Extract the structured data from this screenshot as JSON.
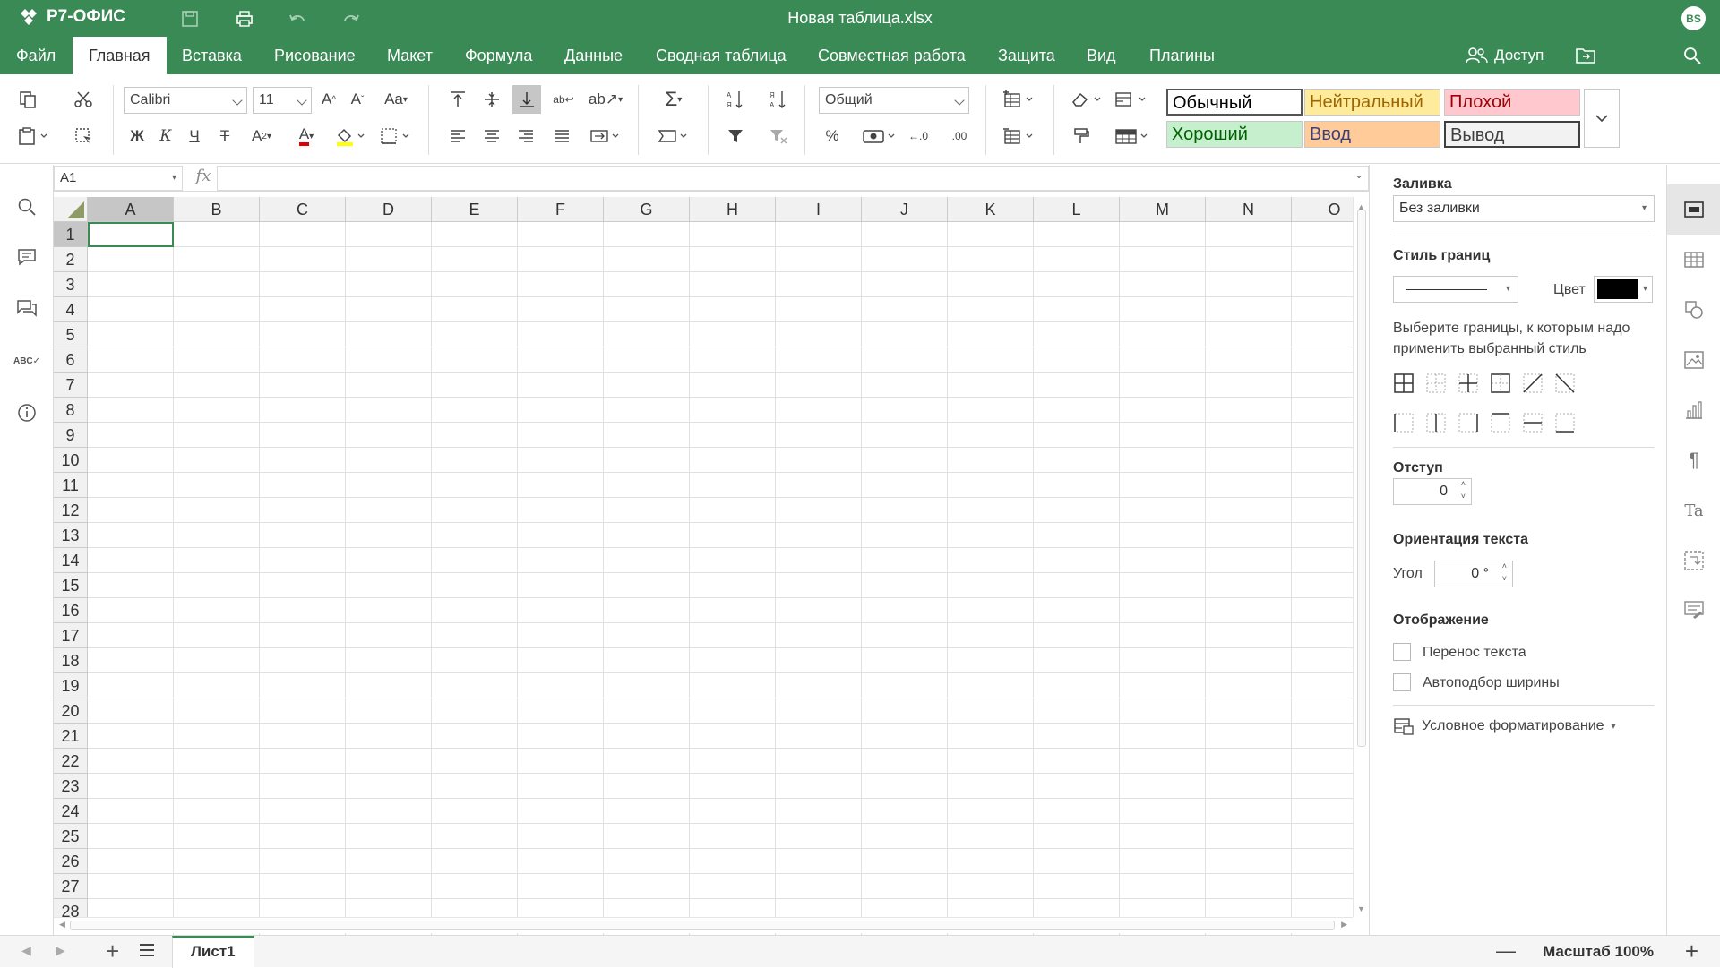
{
  "app": {
    "logo": "Р7-ОФИС",
    "title": "Новая таблица.xlsx",
    "user_initials": "BS"
  },
  "menu": {
    "tabs": [
      "Файл",
      "Главная",
      "Вставка",
      "Рисование",
      "Макет",
      "Формула",
      "Данные",
      "Сводная таблица",
      "Совместная работа",
      "Защита",
      "Вид",
      "Плагины"
    ],
    "active": "Главная",
    "access": "Доступ"
  },
  "toolbar": {
    "font_name": "Calibri",
    "font_size": "11",
    "number_format": "Общий",
    "styles": [
      {
        "name": "Обычный",
        "bg": "#ffffff",
        "fg": "#000000"
      },
      {
        "name": "Нейтральный",
        "bg": "#ffeb9c",
        "fg": "#9c6500"
      },
      {
        "name": "Плохой",
        "bg": "#ffc7ce",
        "fg": "#9c0006"
      },
      {
        "name": "Хороший",
        "bg": "#c6efce",
        "fg": "#006100"
      },
      {
        "name": "Ввод",
        "bg": "#ffcc99",
        "fg": "#3f3f76"
      },
      {
        "name": "Вывод",
        "bg": "#f2f2f2",
        "fg": "#3f3f3f"
      }
    ]
  },
  "formula": {
    "cell_ref": "A1",
    "fx": "fx",
    "content": ""
  },
  "sheet": {
    "columns": [
      "A",
      "B",
      "C",
      "D",
      "E",
      "F",
      "G",
      "H",
      "I",
      "J",
      "K",
      "L",
      "M",
      "N",
      "O"
    ],
    "rows": [
      "1",
      "2",
      "3",
      "4",
      "5",
      "6",
      "7",
      "8",
      "9",
      "10",
      "11",
      "12",
      "13",
      "14",
      "15",
      "16",
      "17",
      "18",
      "19",
      "20",
      "21",
      "22",
      "23",
      "24",
      "25",
      "26",
      "27",
      "28"
    ],
    "selected_col": "A",
    "selected_row": "1"
  },
  "panel": {
    "fill_label": "Заливка",
    "fill_value": "Без заливки",
    "border_style_label": "Стиль границ",
    "color_label": "Цвет",
    "border_color": "#000000",
    "border_hint": "Выберите границы, к которым надо применить выбранный стиль",
    "indent_label": "Отступ",
    "indent_value": "0",
    "orientation_label": "Ориентация текста",
    "angle_label": "Угол",
    "angle_value": "0 °",
    "display_label": "Отображение",
    "wrap_text": "Перенос текста",
    "autofit": "Автоподбор ширины",
    "cond_format": "Условное форматирование"
  },
  "status": {
    "sheet_tab": "Лист1",
    "zoom": "Масштаб 100%"
  },
  "colors": {
    "brand": "#3a8a56",
    "selection": "#3a8a56"
  }
}
